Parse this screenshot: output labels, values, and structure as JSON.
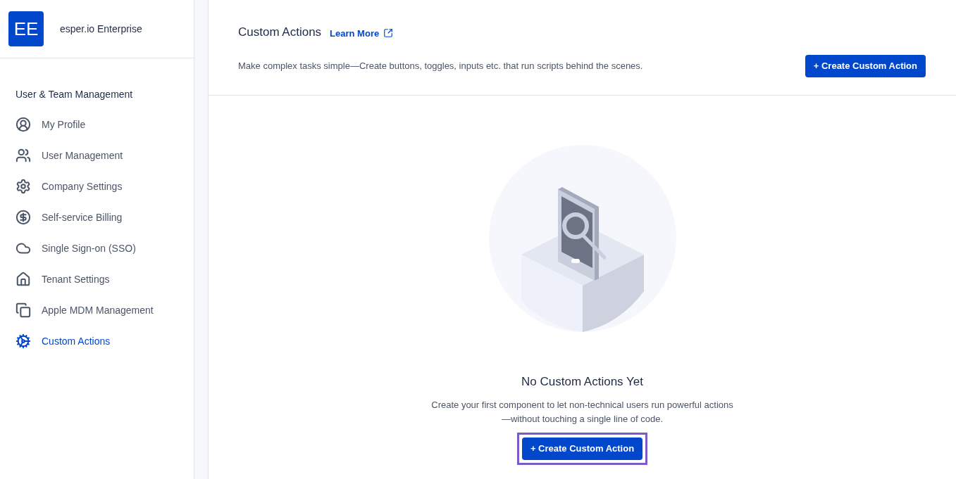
{
  "org": {
    "badge": "EE",
    "name": "esper.io Enterprise"
  },
  "sidebar": {
    "section": "User & Team Management",
    "items": [
      {
        "label": "My Profile",
        "selected": false
      },
      {
        "label": "User Management",
        "selected": false
      },
      {
        "label": "Company Settings",
        "selected": false
      },
      {
        "label": "Self-service Billing",
        "selected": false
      },
      {
        "label": "Single Sign-on (SSO)",
        "selected": false
      },
      {
        "label": "Tenant Settings",
        "selected": false
      },
      {
        "label": "Apple MDM Management",
        "selected": false
      },
      {
        "label": "Custom Actions",
        "selected": true
      }
    ]
  },
  "header": {
    "title": "Custom Actions",
    "link": "Learn More",
    "description": "Make complex tasks simple—Create buttons, toggles, inputs etc. that run scripts behind the scenes.",
    "button": "+ Create Custom Action"
  },
  "empty_state": {
    "title": "No Custom Actions Yet",
    "message": "Create your first component to let non-technical users run powerful actions—without touching a single line of code.",
    "button": "+ Create Custom Action",
    "highlighted": true
  }
}
